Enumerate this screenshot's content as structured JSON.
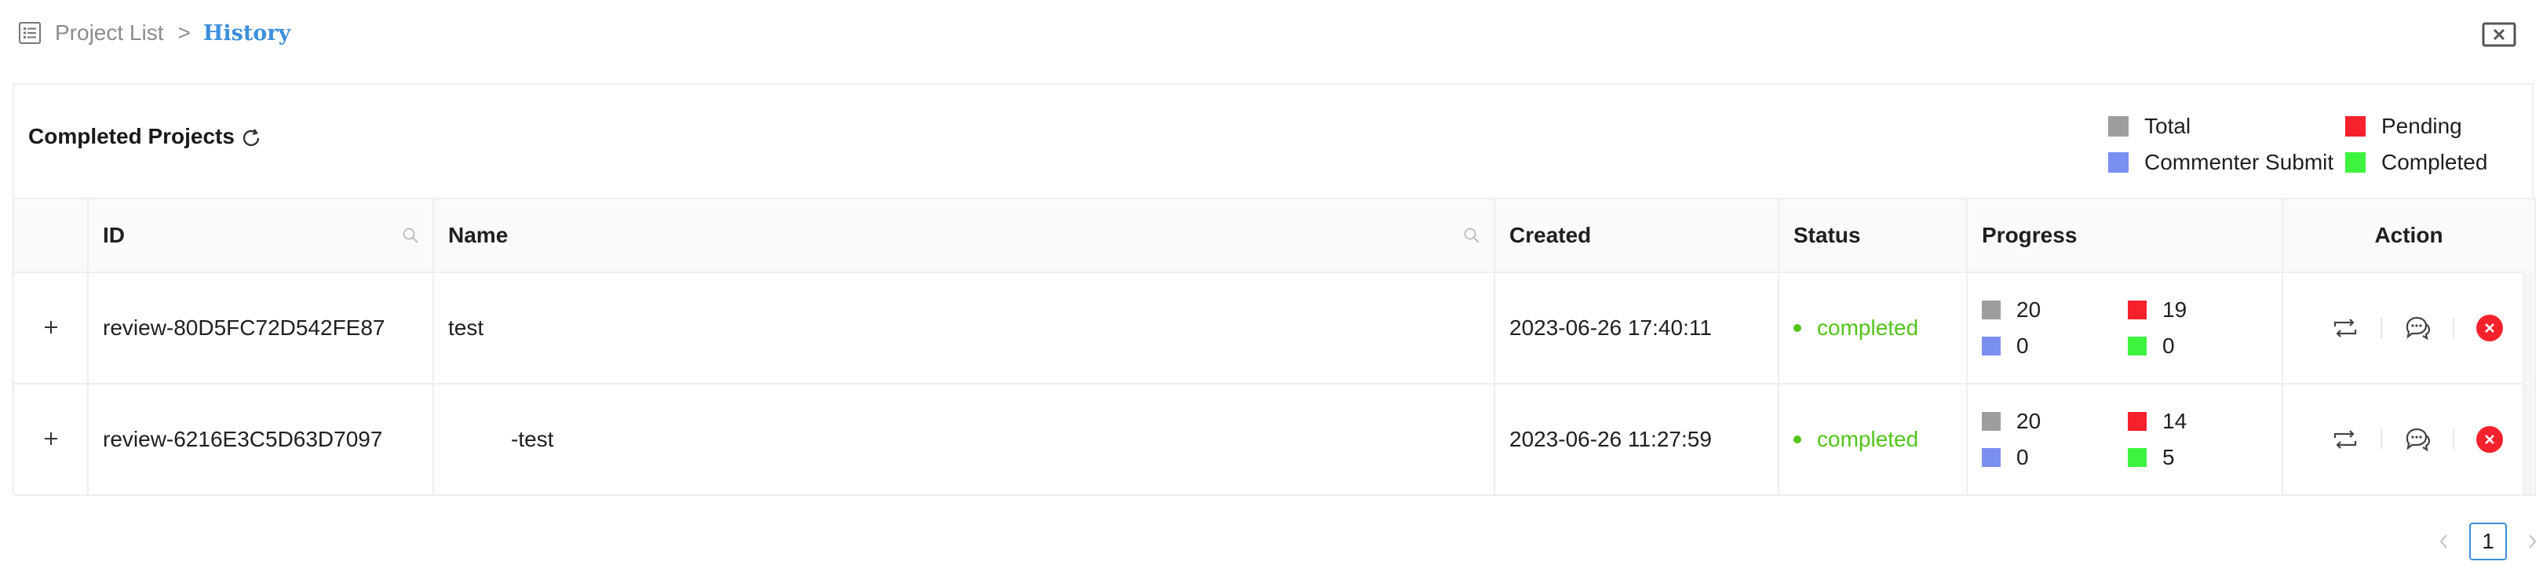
{
  "breadcrumb": {
    "root": "Project List",
    "separator": ">",
    "current": "History"
  },
  "icons": {
    "list": "list-icon",
    "close": "close-icon",
    "refresh": "refresh-icon",
    "search": "search-icon",
    "expand": "plus-icon",
    "retry": "retry-icon",
    "comments": "comments-icon",
    "delete": "delete-icon"
  },
  "panel": {
    "title": "Completed Projects"
  },
  "legend": [
    {
      "label": "Total",
      "color": "#9e9e9e"
    },
    {
      "label": "Pending",
      "color": "#f5222d"
    },
    {
      "label": "Commenter Submit",
      "color": "#7b8ff0"
    },
    {
      "label": "Completed",
      "color": "#3ef33e"
    }
  ],
  "table": {
    "columns": [
      "ID",
      "Name",
      "Created",
      "Status",
      "Progress",
      "Action"
    ],
    "rows": [
      {
        "id": "review-80D5FC72D542FE87",
        "name": "test",
        "created": "2023-06-26 17:40:11",
        "status": "completed",
        "progress": {
          "total": "20",
          "pending": "19",
          "commenter_submit": "0",
          "completed": "0"
        }
      },
      {
        "id": "review-6216E3C5D63D7097",
        "name": "-test",
        "created": "2023-06-26 11:27:59",
        "status": "completed",
        "progress": {
          "total": "20",
          "pending": "14",
          "commenter_submit": "0",
          "completed": "5"
        }
      }
    ]
  },
  "colors": {
    "accent": "#3b8fdc",
    "status_completed": "#52c41a",
    "total": "#9e9e9e",
    "pending": "#f5222d",
    "commenter_submit": "#7b8ff0",
    "completed": "#3ef33e",
    "delete": "#f5222d"
  },
  "pagination": {
    "current_page": "1",
    "prev_icon": "chevron-left-icon",
    "next_icon": "chevron-right-icon"
  }
}
